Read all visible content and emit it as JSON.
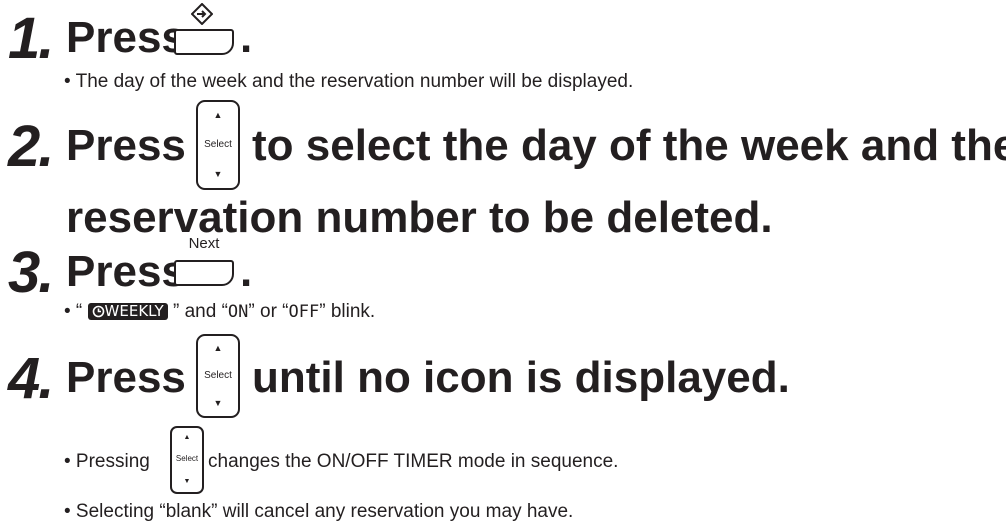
{
  "steps": [
    {
      "number": "1.",
      "text": "Press",
      "suffix": ".",
      "button_icon": "enter-diamond-icon",
      "note": "• The day of the week and the reservation number will be displayed."
    },
    {
      "number": "2.",
      "text": "Press",
      "after": "to select the day of the week and the",
      "line2": "reservation number to be deleted.",
      "button": {
        "up": "▲",
        "label": "Select",
        "down": "▼"
      }
    },
    {
      "number": "3.",
      "text": "Press",
      "suffix": ".",
      "button_label": "Next",
      "note": {
        "open1": "• “",
        "badge_icon": "clock-icon",
        "badge": "WEEKLY",
        "close1": "” and “",
        "on": "ON",
        "mid": "” or “",
        "off": "OFF",
        "end": "” blink."
      }
    },
    {
      "number": "4.",
      "text": "Press",
      "after": "until no icon is displayed.",
      "button": {
        "up": "▲",
        "label": "Select",
        "down": "▼"
      }
    }
  ],
  "notes": [
    {
      "before": "• Pressing",
      "button": {
        "up": "▲",
        "label": "Select",
        "down": "▼"
      },
      "after": "changes the ON/OFF TIMER mode in sequence."
    },
    {
      "text": "• Selecting “blank” will cancel any reservation you may have."
    }
  ]
}
